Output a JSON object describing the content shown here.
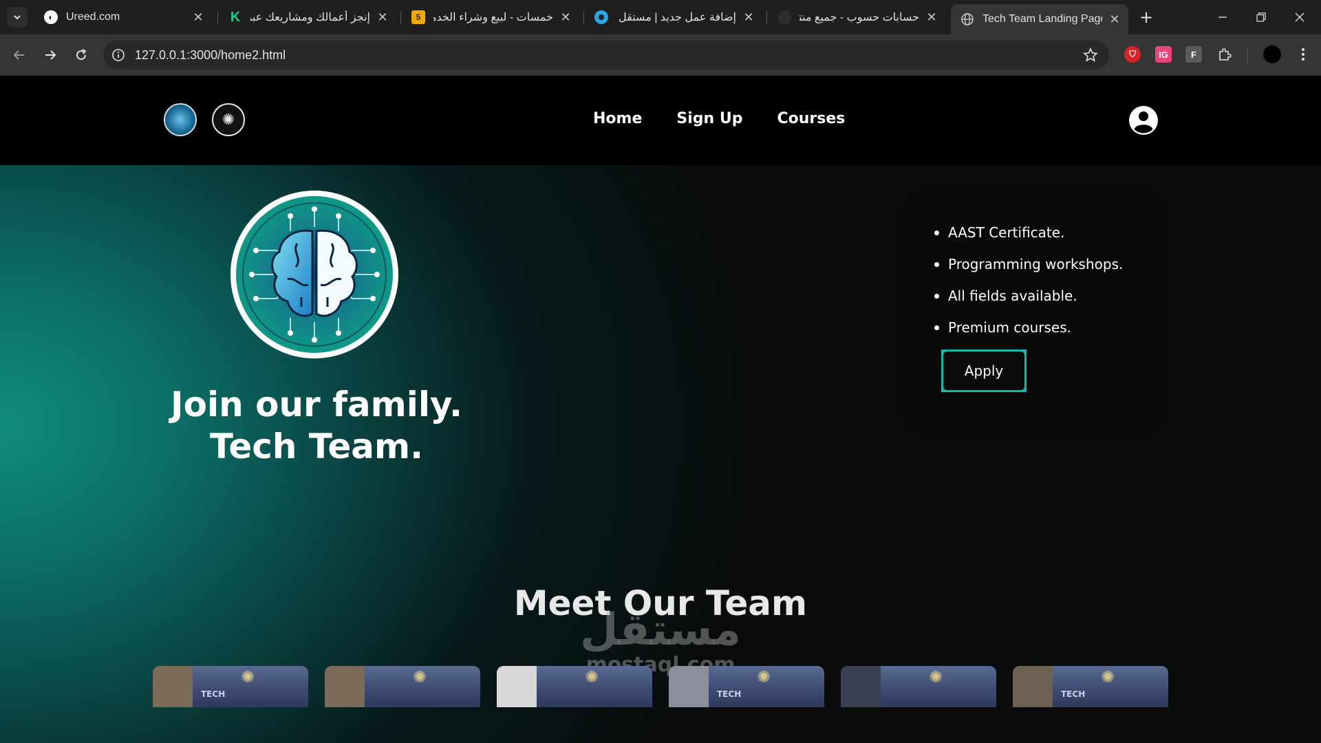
{
  "browser": {
    "tabs": [
      {
        "title": "Ureed.com",
        "rtl": false,
        "favicon": "ureed-icon",
        "active": false
      },
      {
        "title": "إنجز أعمالك ومشاريعك عبر الإنترنت",
        "rtl": true,
        "favicon": "kafiil-icon",
        "active": false
      },
      {
        "title": "خمسات - لبيع وشراء الخدمات المصغرة",
        "rtl": true,
        "favicon": "khamsat-icon",
        "active": false
      },
      {
        "title": "إضافة عمل جديد | مستقل",
        "rtl": true,
        "favicon": "mostaql-icon",
        "active": false
      },
      {
        "title": "حسابات حسوب - جميع منتجاتك",
        "rtl": true,
        "favicon": "hsoub-icon",
        "active": false
      },
      {
        "title": "Tech Team Landing Page",
        "rtl": false,
        "favicon": "globe-icon",
        "active": true
      }
    ],
    "khamsat_badge": "5",
    "url": "127.0.0.1:3000/home2.html",
    "extensions": {
      "ext2": "IG",
      "ext3": "F"
    },
    "colors": {
      "chrome_bg": "#1f1f1f",
      "toolbar_bg": "#353535"
    }
  },
  "site": {
    "nav": {
      "links": [
        "Home",
        "Sign Up",
        "Courses"
      ]
    },
    "hero": {
      "title_line1": "Join our family.",
      "title_line2": "Tech Team."
    },
    "card": {
      "items": [
        "AAST Certificate.",
        "Programming workshops.",
        "All fields available.",
        "Premium courses."
      ],
      "apply_label": "Apply"
    },
    "team": {
      "title": "Meet Our Team",
      "members": [
        {
          "caption": "TECH"
        },
        {
          "caption": ""
        },
        {
          "caption": ""
        },
        {
          "caption": "TECH"
        },
        {
          "caption": ""
        },
        {
          "caption": "TECH"
        }
      ]
    },
    "watermark": {
      "arabic": "مستقل",
      "latin": "mostaql.com"
    },
    "colors": {
      "accent": "#18b8a8",
      "accent2": "#2aa0d8",
      "teal_glow": "#0f8b80"
    }
  }
}
